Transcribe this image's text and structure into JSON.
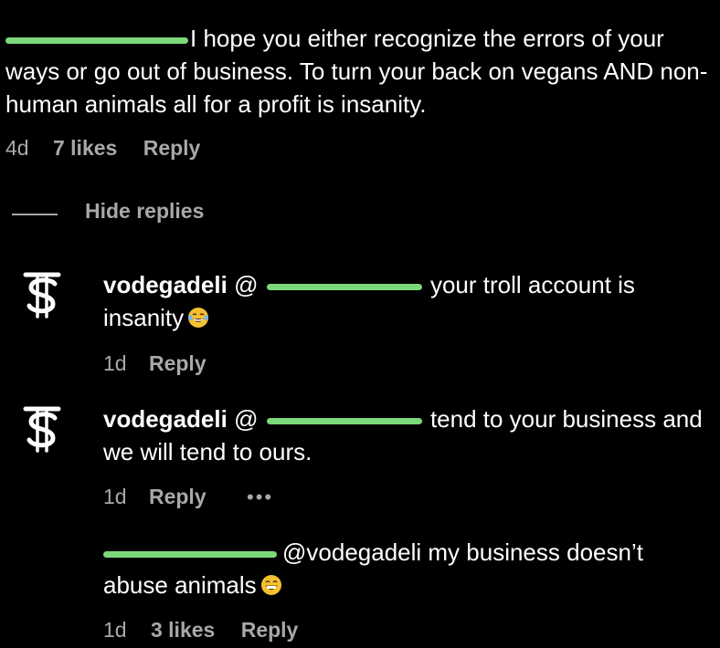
{
  "comment": {
    "text": "I hope you either recognize the errors of your ways or go out of business. To turn your back on vegans AND non-human animals all for a profit is insanity.",
    "time": "4d",
    "likes": "7 likes",
    "reply_label": "Reply"
  },
  "hide_replies_label": "Hide replies",
  "replies": [
    {
      "username": "vodegadeli",
      "mention_prefix": "@",
      "text": "your troll account is insanity",
      "emoji": "laughing-tears-emoji",
      "time": "1d",
      "reply_label": "Reply"
    },
    {
      "username": "vodegadeli",
      "mention_prefix": "@",
      "text": "tend to your business and we will tend to ours.",
      "time": "1d",
      "reply_label": "Reply",
      "more_label": "•••"
    },
    {
      "text": "@vodegadeli my business doesn’t abuse animals",
      "emoji": "grinning-emoji",
      "time": "1d",
      "likes": "3 likes",
      "reply_label": "Reply"
    }
  ],
  "colors": {
    "background": "#000000",
    "text": "#ffffff",
    "meta": "#a8a8a8",
    "redaction": "#7dd87a"
  }
}
